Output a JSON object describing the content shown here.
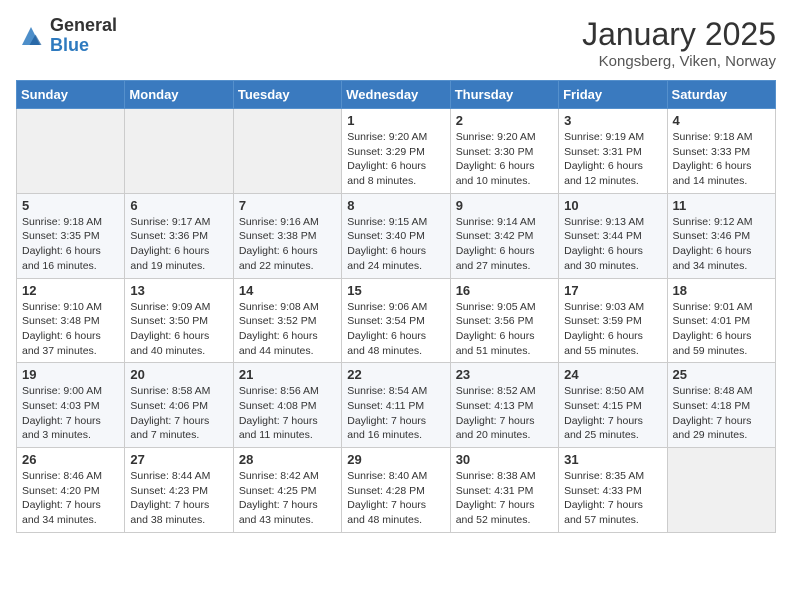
{
  "logo": {
    "general": "General",
    "blue": "Blue"
  },
  "header": {
    "title": "January 2025",
    "subtitle": "Kongsberg, Viken, Norway"
  },
  "weekdays": [
    "Sunday",
    "Monday",
    "Tuesday",
    "Wednesday",
    "Thursday",
    "Friday",
    "Saturday"
  ],
  "weeks": [
    [
      {
        "day": "",
        "info": ""
      },
      {
        "day": "",
        "info": ""
      },
      {
        "day": "",
        "info": ""
      },
      {
        "day": "1",
        "info": "Sunrise: 9:20 AM\nSunset: 3:29 PM\nDaylight: 6 hours and 8 minutes."
      },
      {
        "day": "2",
        "info": "Sunrise: 9:20 AM\nSunset: 3:30 PM\nDaylight: 6 hours and 10 minutes."
      },
      {
        "day": "3",
        "info": "Sunrise: 9:19 AM\nSunset: 3:31 PM\nDaylight: 6 hours and 12 minutes."
      },
      {
        "day": "4",
        "info": "Sunrise: 9:18 AM\nSunset: 3:33 PM\nDaylight: 6 hours and 14 minutes."
      }
    ],
    [
      {
        "day": "5",
        "info": "Sunrise: 9:18 AM\nSunset: 3:35 PM\nDaylight: 6 hours and 16 minutes."
      },
      {
        "day": "6",
        "info": "Sunrise: 9:17 AM\nSunset: 3:36 PM\nDaylight: 6 hours and 19 minutes."
      },
      {
        "day": "7",
        "info": "Sunrise: 9:16 AM\nSunset: 3:38 PM\nDaylight: 6 hours and 22 minutes."
      },
      {
        "day": "8",
        "info": "Sunrise: 9:15 AM\nSunset: 3:40 PM\nDaylight: 6 hours and 24 minutes."
      },
      {
        "day": "9",
        "info": "Sunrise: 9:14 AM\nSunset: 3:42 PM\nDaylight: 6 hours and 27 minutes."
      },
      {
        "day": "10",
        "info": "Sunrise: 9:13 AM\nSunset: 3:44 PM\nDaylight: 6 hours and 30 minutes."
      },
      {
        "day": "11",
        "info": "Sunrise: 9:12 AM\nSunset: 3:46 PM\nDaylight: 6 hours and 34 minutes."
      }
    ],
    [
      {
        "day": "12",
        "info": "Sunrise: 9:10 AM\nSunset: 3:48 PM\nDaylight: 6 hours and 37 minutes."
      },
      {
        "day": "13",
        "info": "Sunrise: 9:09 AM\nSunset: 3:50 PM\nDaylight: 6 hours and 40 minutes."
      },
      {
        "day": "14",
        "info": "Sunrise: 9:08 AM\nSunset: 3:52 PM\nDaylight: 6 hours and 44 minutes."
      },
      {
        "day": "15",
        "info": "Sunrise: 9:06 AM\nSunset: 3:54 PM\nDaylight: 6 hours and 48 minutes."
      },
      {
        "day": "16",
        "info": "Sunrise: 9:05 AM\nSunset: 3:56 PM\nDaylight: 6 hours and 51 minutes."
      },
      {
        "day": "17",
        "info": "Sunrise: 9:03 AM\nSunset: 3:59 PM\nDaylight: 6 hours and 55 minutes."
      },
      {
        "day": "18",
        "info": "Sunrise: 9:01 AM\nSunset: 4:01 PM\nDaylight: 6 hours and 59 minutes."
      }
    ],
    [
      {
        "day": "19",
        "info": "Sunrise: 9:00 AM\nSunset: 4:03 PM\nDaylight: 7 hours and 3 minutes."
      },
      {
        "day": "20",
        "info": "Sunrise: 8:58 AM\nSunset: 4:06 PM\nDaylight: 7 hours and 7 minutes."
      },
      {
        "day": "21",
        "info": "Sunrise: 8:56 AM\nSunset: 4:08 PM\nDaylight: 7 hours and 11 minutes."
      },
      {
        "day": "22",
        "info": "Sunrise: 8:54 AM\nSunset: 4:11 PM\nDaylight: 7 hours and 16 minutes."
      },
      {
        "day": "23",
        "info": "Sunrise: 8:52 AM\nSunset: 4:13 PM\nDaylight: 7 hours and 20 minutes."
      },
      {
        "day": "24",
        "info": "Sunrise: 8:50 AM\nSunset: 4:15 PM\nDaylight: 7 hours and 25 minutes."
      },
      {
        "day": "25",
        "info": "Sunrise: 8:48 AM\nSunset: 4:18 PM\nDaylight: 7 hours and 29 minutes."
      }
    ],
    [
      {
        "day": "26",
        "info": "Sunrise: 8:46 AM\nSunset: 4:20 PM\nDaylight: 7 hours and 34 minutes."
      },
      {
        "day": "27",
        "info": "Sunrise: 8:44 AM\nSunset: 4:23 PM\nDaylight: 7 hours and 38 minutes."
      },
      {
        "day": "28",
        "info": "Sunrise: 8:42 AM\nSunset: 4:25 PM\nDaylight: 7 hours and 43 minutes."
      },
      {
        "day": "29",
        "info": "Sunrise: 8:40 AM\nSunset: 4:28 PM\nDaylight: 7 hours and 48 minutes."
      },
      {
        "day": "30",
        "info": "Sunrise: 8:38 AM\nSunset: 4:31 PM\nDaylight: 7 hours and 52 minutes."
      },
      {
        "day": "31",
        "info": "Sunrise: 8:35 AM\nSunset: 4:33 PM\nDaylight: 7 hours and 57 minutes."
      },
      {
        "day": "",
        "info": ""
      }
    ]
  ]
}
